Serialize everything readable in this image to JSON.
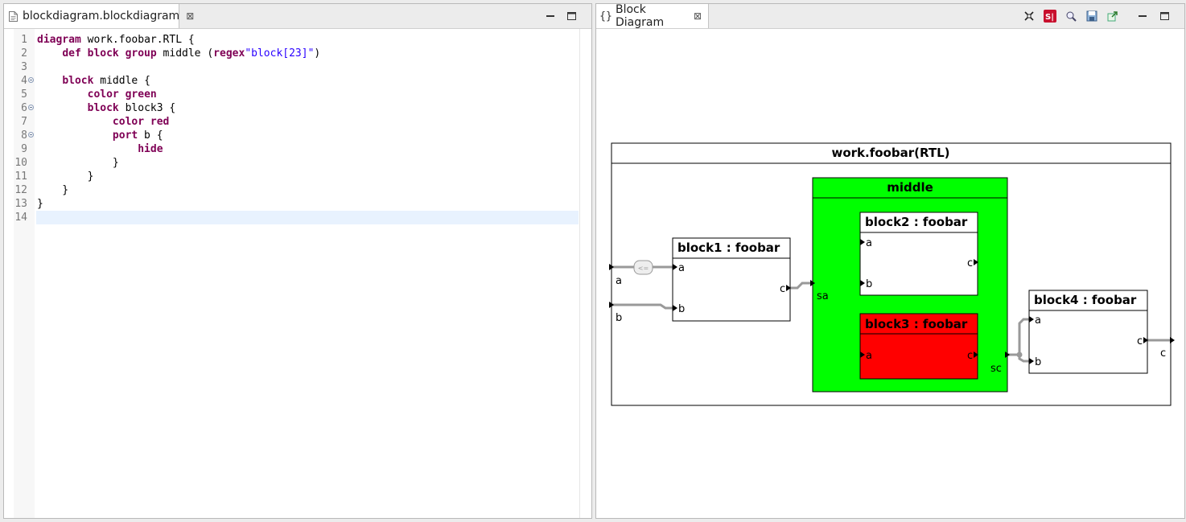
{
  "editor": {
    "tab_title": "blockdiagram.blockdiagram",
    "lines": [
      {
        "n": "1",
        "fold": false,
        "tokens": [
          {
            "t": "diagram",
            "c": "kw"
          },
          {
            "t": " work.foobar.RTL {",
            "c": ""
          }
        ]
      },
      {
        "n": "2",
        "fold": false,
        "tokens": [
          {
            "t": "    ",
            "c": ""
          },
          {
            "t": "def block group",
            "c": "kw"
          },
          {
            "t": " middle (",
            "c": ""
          },
          {
            "t": "regex",
            "c": "kw"
          },
          {
            "t": "\"block[23]\"",
            "c": "str"
          },
          {
            "t": ")",
            "c": ""
          }
        ]
      },
      {
        "n": "3",
        "fold": false,
        "tokens": []
      },
      {
        "n": "4",
        "fold": true,
        "tokens": [
          {
            "t": "    ",
            "c": ""
          },
          {
            "t": "block",
            "c": "kw"
          },
          {
            "t": " middle {",
            "c": ""
          }
        ]
      },
      {
        "n": "5",
        "fold": false,
        "tokens": [
          {
            "t": "        ",
            "c": ""
          },
          {
            "t": "color green",
            "c": "kw"
          }
        ]
      },
      {
        "n": "6",
        "fold": true,
        "tokens": [
          {
            "t": "        ",
            "c": ""
          },
          {
            "t": "block",
            "c": "kw"
          },
          {
            "t": " block3 {",
            "c": ""
          }
        ]
      },
      {
        "n": "7",
        "fold": false,
        "tokens": [
          {
            "t": "            ",
            "c": ""
          },
          {
            "t": "color red",
            "c": "kw"
          }
        ]
      },
      {
        "n": "8",
        "fold": true,
        "tokens": [
          {
            "t": "            ",
            "c": ""
          },
          {
            "t": "port",
            "c": "kw"
          },
          {
            "t": " b {",
            "c": ""
          }
        ]
      },
      {
        "n": "9",
        "fold": false,
        "tokens": [
          {
            "t": "                ",
            "c": ""
          },
          {
            "t": "hide",
            "c": "kw"
          }
        ]
      },
      {
        "n": "10",
        "fold": false,
        "tokens": [
          {
            "t": "            }",
            "c": ""
          }
        ]
      },
      {
        "n": "11",
        "fold": false,
        "tokens": [
          {
            "t": "        }",
            "c": ""
          }
        ]
      },
      {
        "n": "12",
        "fold": false,
        "tokens": [
          {
            "t": "    }",
            "c": ""
          }
        ]
      },
      {
        "n": "13",
        "fold": false,
        "tokens": [
          {
            "t": "}",
            "c": ""
          }
        ]
      },
      {
        "n": "14",
        "fold": false,
        "tokens": [],
        "current": true
      }
    ]
  },
  "diagram_view": {
    "tab_title": "Block Diagram",
    "toolbar": [
      "fit-icon",
      "sirius-icon",
      "zoom-icon",
      "save-image-icon",
      "export-icon"
    ]
  },
  "diagram": {
    "root_title": "work.foobar(RTL)",
    "root_ports": {
      "a": "a",
      "b": "b",
      "c": "c"
    },
    "converter_label": "<=",
    "group": {
      "title": "middle",
      "color": "#00ff00",
      "port_in": "sa",
      "port_out": "sc"
    },
    "blocks": {
      "block1": {
        "title": "block1 : foobar",
        "a": "a",
        "b": "b",
        "c": "c"
      },
      "block2": {
        "title": "block2 : foobar",
        "a": "a",
        "b": "b",
        "c": "c"
      },
      "block3": {
        "title": "block3 : foobar",
        "a": "a",
        "c": "c",
        "color": "#ff0000"
      },
      "block4": {
        "title": "block4 : foobar",
        "a": "a",
        "b": "b",
        "c": "c"
      }
    }
  },
  "colors": {
    "keyword": "#7f0055",
    "string": "#2a00ff",
    "wire": "#999999"
  }
}
